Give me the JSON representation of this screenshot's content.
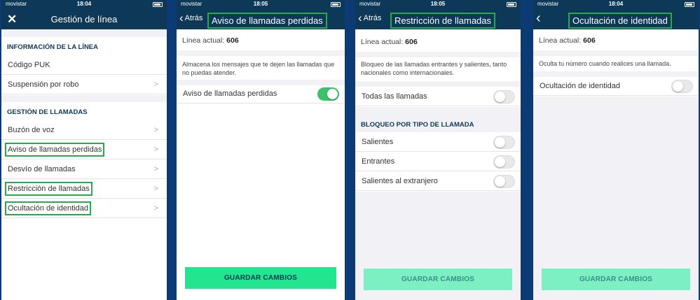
{
  "status": {
    "carrier": "movistar",
    "times": [
      "18:04",
      "18:05",
      "18:05",
      "18:04"
    ]
  },
  "screen1": {
    "title": "Gestión de línea",
    "section_info": "INFORMACIÓN DE LA LÍNEA",
    "items_info": [
      "Código PUK",
      "Suspensión por robo"
    ],
    "section_calls": "GESTIÓN DE LLAMADAS",
    "items_calls": [
      "Buzón de voz",
      "Aviso de llamadas perdidas",
      "Desvío de llamadas",
      "Restricción de llamadas",
      "Ocultación de identidad"
    ]
  },
  "screen2": {
    "back_label": "Atrás",
    "title": "Aviso de llamadas perdidas",
    "line_label": "Línea actual:",
    "line_value": "606",
    "description": "Almacena los mensajes que te dejen las llamadas que no puedas atender.",
    "toggle_label": "Aviso de llamadas perdidas",
    "toggle_on": true,
    "save_label": "GUARDAR CAMBIOS"
  },
  "screen3": {
    "back_label": "Atrás",
    "title": "Restricción de llamadas",
    "line_label": "Línea actual:",
    "line_value": "606",
    "description": "Bloqueo de las llamadas entrantes y salientes, tanto nacionales como internacionales.",
    "all_calls_label": "Todas las llamadas",
    "section_type": "BLOQUEO POR TIPO DE LLAMADA",
    "type_items": [
      "Salientes",
      "Entrantes",
      "Salientes al extranjero"
    ],
    "save_label": "GUARDAR CAMBIOS"
  },
  "screen4": {
    "title": "Ocultación de identidad",
    "line_label": "Línea actual:",
    "line_value": "606",
    "description": "Oculta tu número cuando realices una llamada.",
    "toggle_label": "Ocultación de identidad",
    "save_label": "GUARDAR CAMBIOS"
  },
  "colors": {
    "navbar": "#0d3857",
    "frame": "#0c3a74",
    "highlight": "#2ca84a",
    "toggle_on": "#3dc26b",
    "button_active": "#23e48f",
    "button_disabled": "#7cefc3"
  }
}
